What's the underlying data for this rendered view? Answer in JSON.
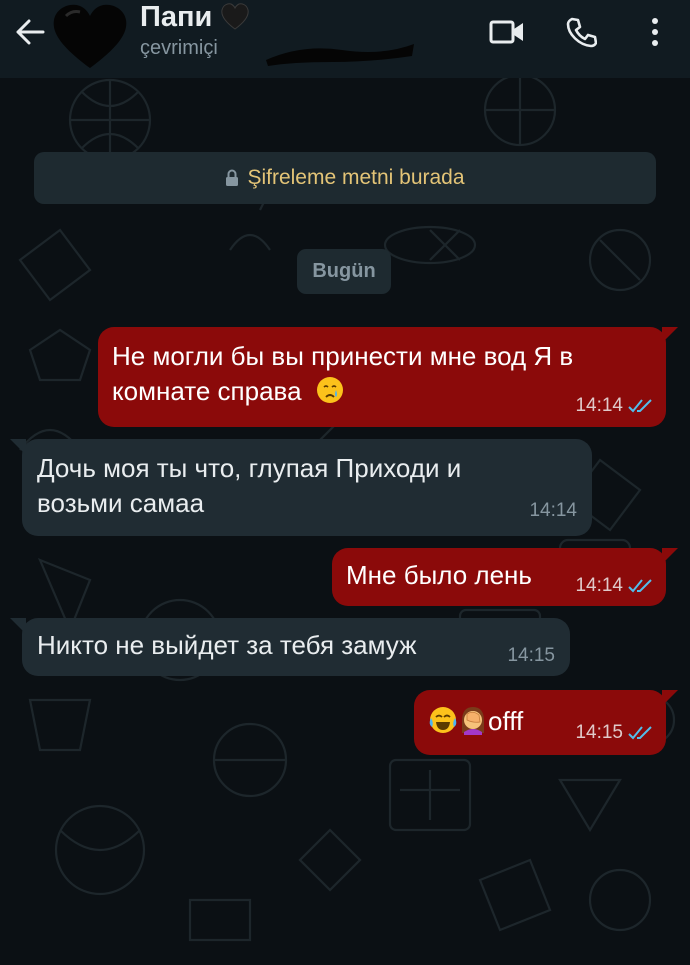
{
  "header": {
    "contact_name": "Папи",
    "status": "çevrimiçi",
    "avatar_icon": "black-heart",
    "name_icon": "black-heart"
  },
  "encryption_notice": "Şifreleme metni burada",
  "date_divider": "Bugün",
  "messages": [
    {
      "direction": "outgoing",
      "lines": [
        "Не могли бы вы принести мне вод Я в",
        "комнате справа"
      ],
      "emoji": [
        "crying-face"
      ],
      "time": "14:14",
      "read": true
    },
    {
      "direction": "incoming",
      "lines": [
        "Дочь моя ты что, глупая Приходи и",
        "возьми самаа"
      ],
      "time": "14:14"
    },
    {
      "direction": "outgoing",
      "lines": [
        "Мне было лень"
      ],
      "time": "14:14",
      "read": true
    },
    {
      "direction": "incoming",
      "lines": [
        "Никто не выйдет за тебя замуж"
      ],
      "time": "14:15"
    },
    {
      "direction": "outgoing",
      "lines": [
        "offf"
      ],
      "emoji": [
        "face-with-tears-of-joy",
        "person-facepalming"
      ],
      "time": "14:15",
      "read": true
    }
  ],
  "colors": {
    "outgoing_bubble": "#8b0a0a",
    "incoming_bubble": "#202c33",
    "read_ticks": "#53bdeb",
    "encryption_text": "#e3c477"
  }
}
